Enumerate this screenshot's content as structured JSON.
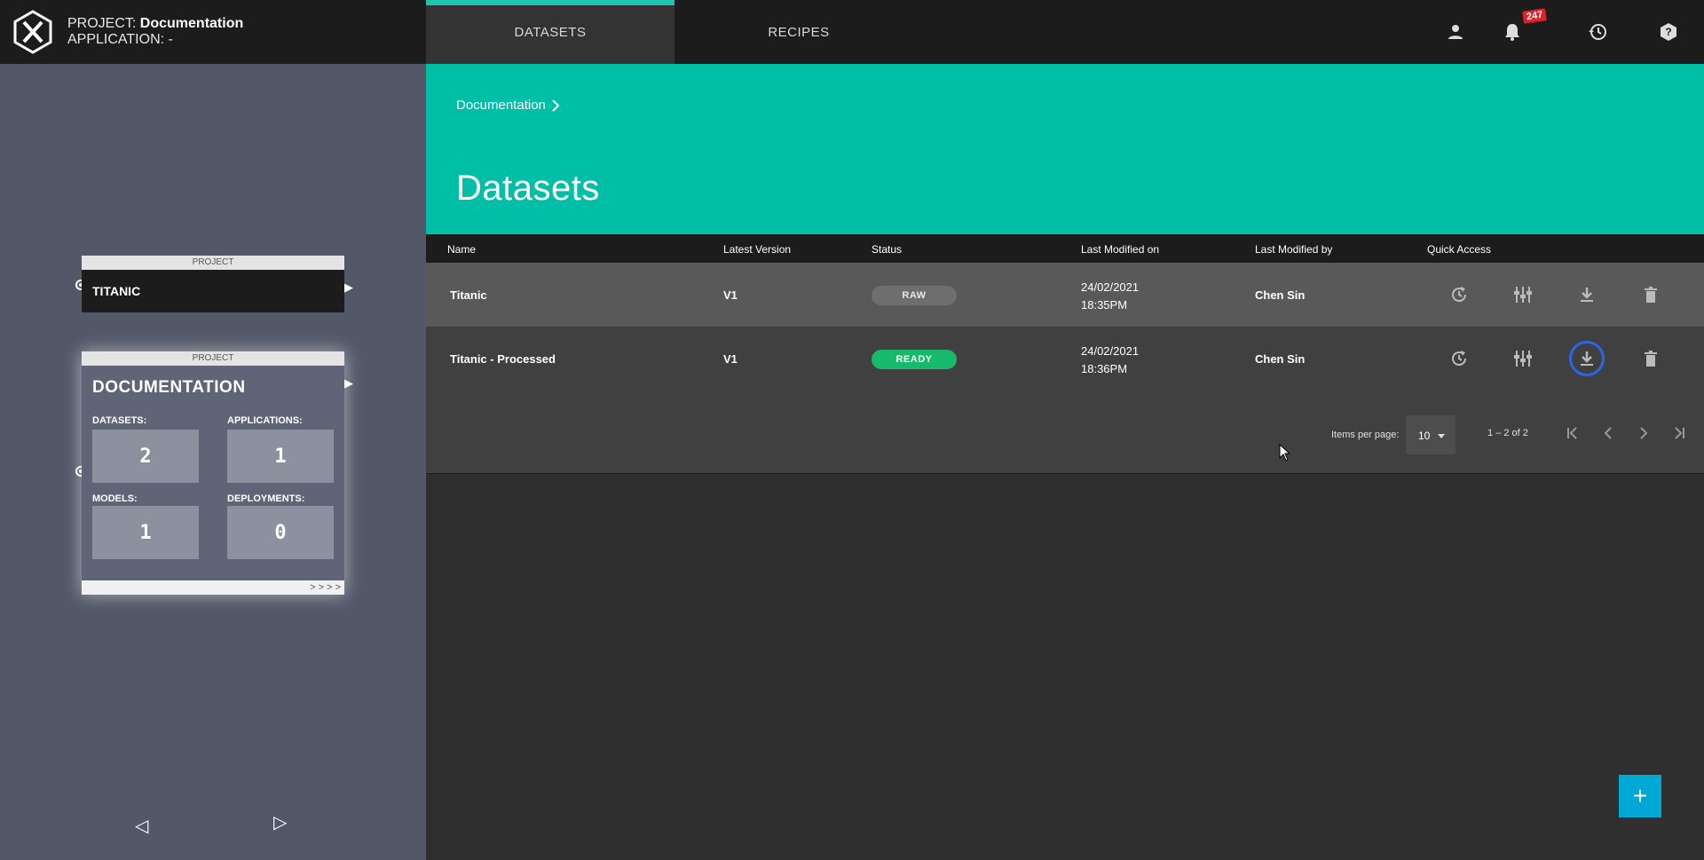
{
  "header": {
    "project_label": "PROJECT:",
    "project_name": "Documentation",
    "application_label": "APPLICATION:",
    "application_name": "-",
    "tabs": [
      {
        "label": "DATASETS",
        "active": true
      },
      {
        "label": "RECIPES",
        "active": false
      }
    ],
    "icons": [
      "user-icon",
      "bell-icon",
      "history-icon",
      "help-icon"
    ],
    "notification_count": "247"
  },
  "leftpanel": {
    "titanic_node": {
      "header": "PROJECT",
      "title": "TITANIC"
    },
    "doc_node": {
      "header": "PROJECT",
      "title": "DOCUMENTATION",
      "stats": [
        {
          "label": "DATASETS:",
          "value": "2"
        },
        {
          "label": "APPLICATIONS:",
          "value": "1"
        },
        {
          "label": "MODELS:",
          "value": "1"
        },
        {
          "label": "DEPLOYMENTS:",
          "value": "0"
        }
      ],
      "footer": "> > > >"
    }
  },
  "main": {
    "breadcrumb": "Documentation",
    "title": "Datasets",
    "accent_color": "#00bfa6"
  },
  "table": {
    "headers": [
      "Name",
      "Latest Version",
      "Status",
      "Last Modified on",
      "Last Modified by",
      "Quick Access"
    ],
    "rows": [
      {
        "name": "Titanic",
        "version": "V1",
        "status": "RAW",
        "date": "24/02/2021",
        "time": "18:35PM",
        "by": "Chen Sin"
      },
      {
        "name": "Titanic - Processed",
        "version": "V1",
        "status": "READY",
        "date": "24/02/2021",
        "time": "18:36PM",
        "by": "Chen Sin"
      }
    ]
  },
  "pager": {
    "items_per_page_label": "Items per page:",
    "items_per_page": "10",
    "range": "1 – 2 of 2"
  },
  "fab": {
    "label": "+"
  }
}
